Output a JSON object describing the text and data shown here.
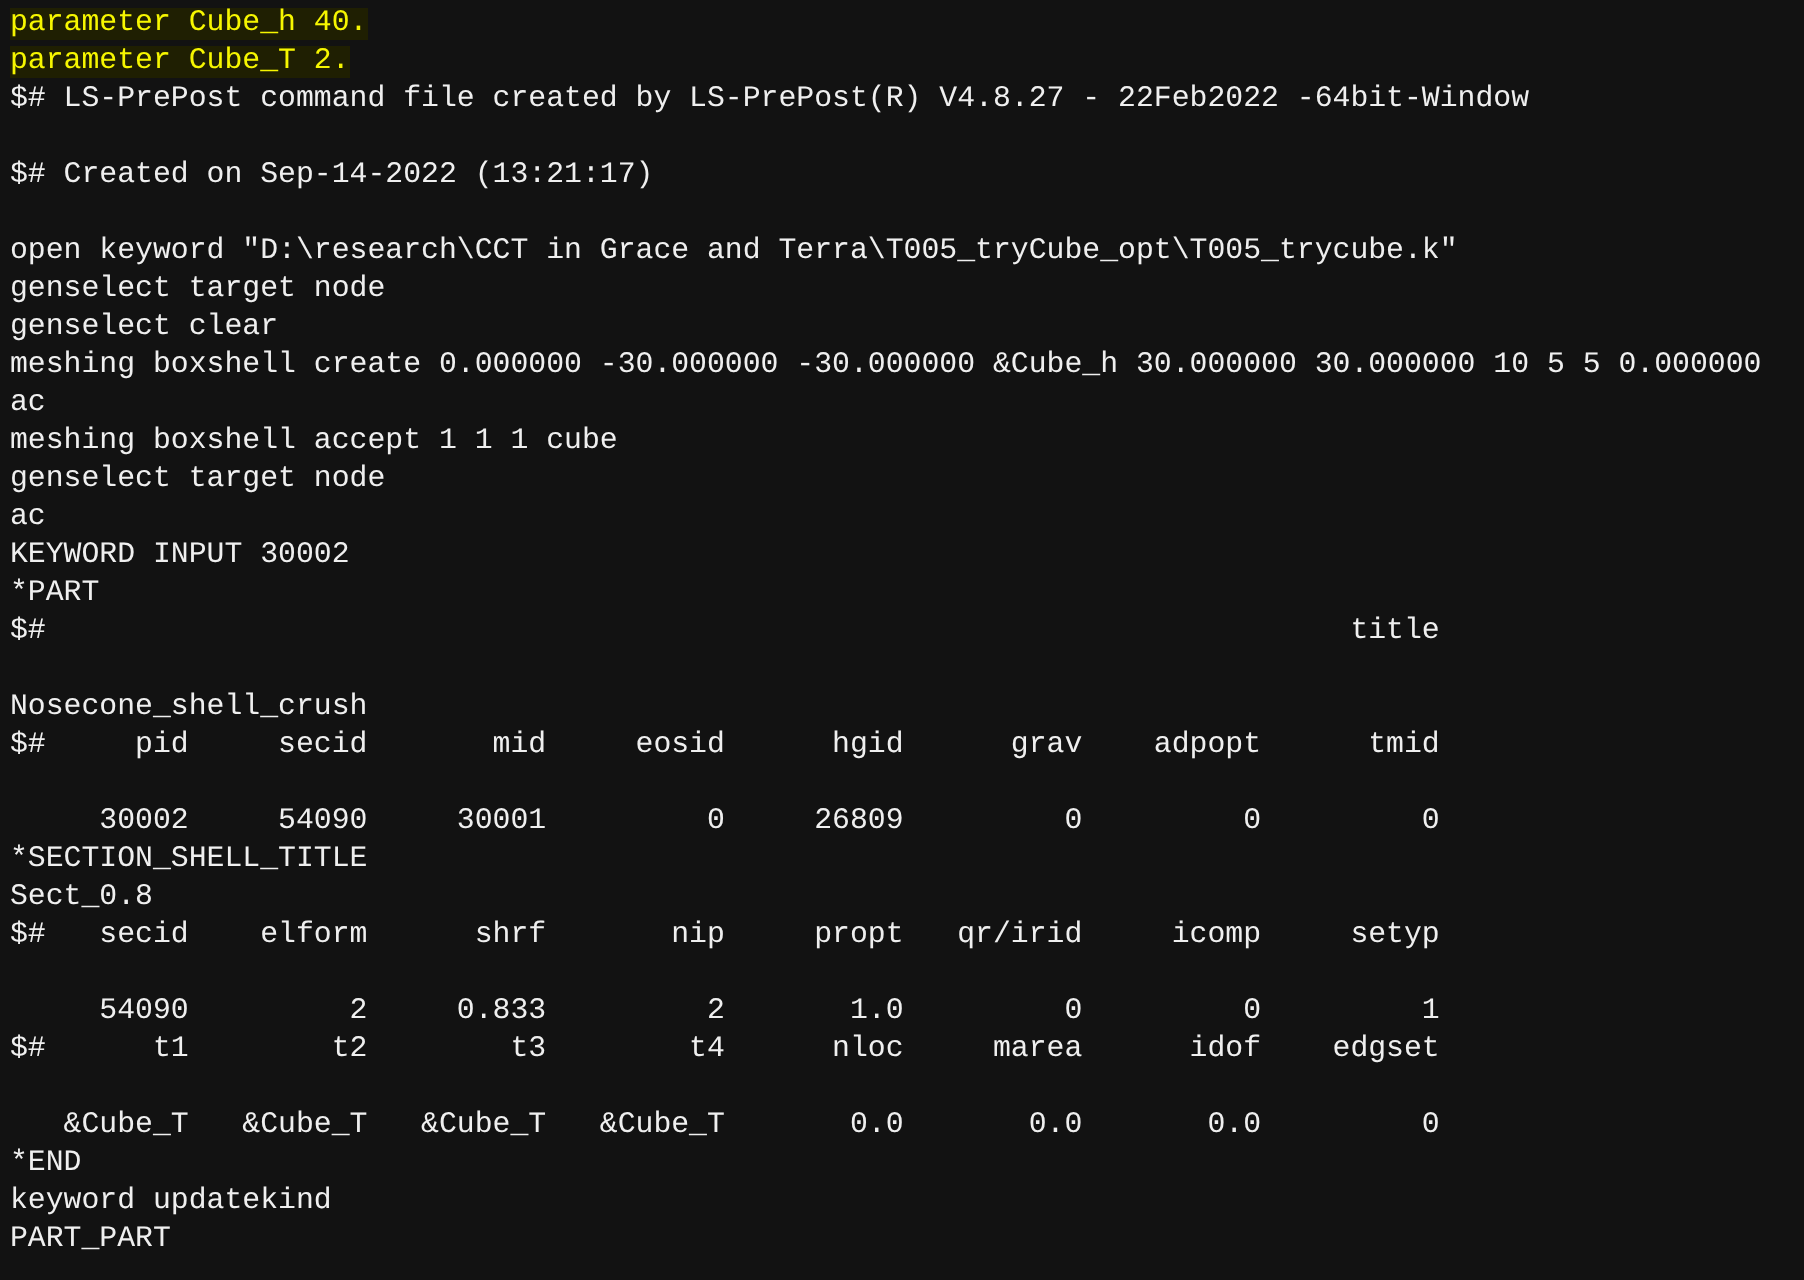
{
  "lines": [
    {
      "kind": "text",
      "text": "parameter Cube_h 40.",
      "highlighted": true
    },
    {
      "kind": "text",
      "text": "parameter Cube_T 2.",
      "highlighted": true
    },
    {
      "kind": "text",
      "text": "$# LS-PrePost command file created by LS-PrePost(R) V4.8.27 - 22Feb2022 -64bit-Window",
      "highlighted": false
    },
    {
      "kind": "blank"
    },
    {
      "kind": "text",
      "text": "$# Created on Sep-14-2022 (13:21:17)",
      "highlighted": false
    },
    {
      "kind": "blank"
    },
    {
      "kind": "text",
      "text": "open keyword \"D:\\research\\CCT in Grace and Terra\\T005_tryCube_opt\\T005_trycube.k\"",
      "highlighted": false
    },
    {
      "kind": "text",
      "text": "genselect target node",
      "highlighted": false
    },
    {
      "kind": "text",
      "text": "genselect clear",
      "highlighted": false
    },
    {
      "kind": "text",
      "text": "meshing boxshell create 0.000000 -30.000000 -30.000000 &Cube_h 30.000000 30.000000 10 5 5 0.000000",
      "highlighted": false
    },
    {
      "kind": "text",
      "text": "ac",
      "highlighted": false
    },
    {
      "kind": "text",
      "text": "meshing boxshell accept 1 1 1 cube",
      "highlighted": false
    },
    {
      "kind": "text",
      "text": "genselect target node",
      "highlighted": false
    },
    {
      "kind": "text",
      "text": "ac",
      "highlighted": false
    },
    {
      "kind": "text",
      "text": "KEYWORD INPUT 30002",
      "highlighted": false
    },
    {
      "kind": "text",
      "text": "*PART",
      "highlighted": false
    },
    {
      "kind": "text",
      "text": "$#                                                                         title",
      "highlighted": false
    },
    {
      "kind": "blank"
    },
    {
      "kind": "text",
      "text": "Nosecone_shell_crush",
      "highlighted": false
    },
    {
      "kind": "text",
      "text": "$#     pid     secid       mid     eosid      hgid      grav    adpopt      tmid",
      "highlighted": false
    },
    {
      "kind": "blank"
    },
    {
      "kind": "text",
      "text": "     30002     54090     30001         0     26809         0         0         0",
      "highlighted": false
    },
    {
      "kind": "text",
      "text": "*SECTION_SHELL_TITLE",
      "highlighted": false
    },
    {
      "kind": "text",
      "text": "Sect_0.8",
      "highlighted": false
    },
    {
      "kind": "text",
      "text": "$#   secid    elform      shrf       nip     propt   qr/irid     icomp     setyp",
      "highlighted": false
    },
    {
      "kind": "blank"
    },
    {
      "kind": "text",
      "text": "     54090         2     0.833         2       1.0         0         0         1",
      "highlighted": false
    },
    {
      "kind": "text",
      "text": "$#      t1        t2        t3        t4      nloc     marea      idof    edgset",
      "highlighted": false
    },
    {
      "kind": "blank"
    },
    {
      "kind": "text",
      "text": "   &Cube_T   &Cube_T   &Cube_T   &Cube_T       0.0       0.0       0.0         0",
      "highlighted": false
    },
    {
      "kind": "text",
      "text": "*END",
      "highlighted": false
    },
    {
      "kind": "text",
      "text": "keyword updatekind",
      "highlighted": false
    },
    {
      "kind": "text",
      "text": "PART_PART",
      "highlighted": false
    }
  ]
}
